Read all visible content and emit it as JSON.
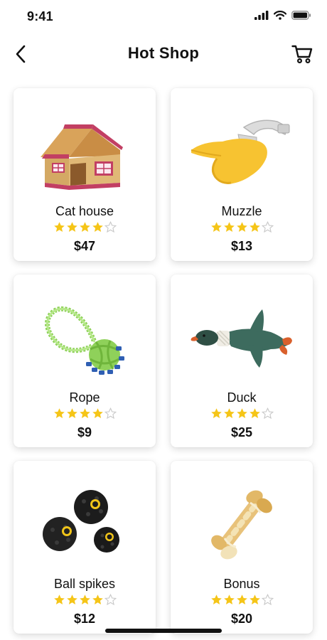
{
  "status_bar": {
    "time": "9:41"
  },
  "header": {
    "title": "Hot Shop",
    "back_icon": "chevron-left-icon",
    "cart_icon": "cart-icon"
  },
  "colors": {
    "star_filled": "#F5C518",
    "star_empty": "#C8C8C8",
    "text": "#111111"
  },
  "products": [
    {
      "name": "Cat house",
      "price": "$47",
      "rating": 4,
      "max_rating": 5,
      "image": "cat-house"
    },
    {
      "name": "Muzzle",
      "price": "$13",
      "rating": 4,
      "max_rating": 5,
      "image": "muzzle"
    },
    {
      "name": "Rope",
      "price": "$9",
      "rating": 4,
      "max_rating": 5,
      "image": "rope"
    },
    {
      "name": "Duck",
      "price": "$25",
      "rating": 4,
      "max_rating": 5,
      "image": "duck"
    },
    {
      "name": "Ball spikes",
      "price": "$12",
      "rating": 4,
      "max_rating": 5,
      "image": "ball-spikes"
    },
    {
      "name": "Bonus",
      "price": "$20",
      "rating": 4,
      "max_rating": 5,
      "image": "bone"
    }
  ]
}
